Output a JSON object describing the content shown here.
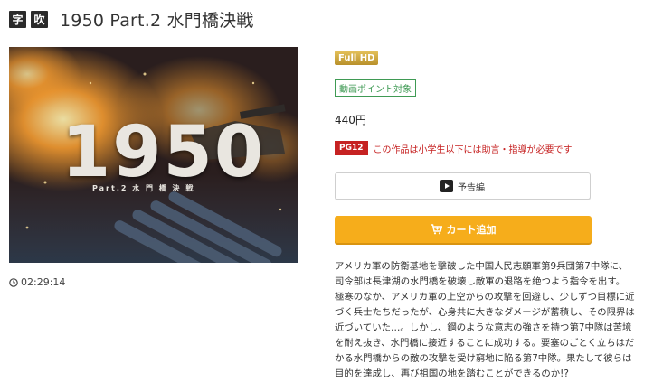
{
  "header": {
    "tags": [
      "字",
      "吹"
    ],
    "title": "1950 Part.2 水門橋決戦"
  },
  "poster": {
    "title_text": "1950",
    "subtitle_text": "Part.2 水 門 橋 決 戦"
  },
  "duration": "02:29:14",
  "badges": {
    "quality": "Full HD",
    "points": "動画ポイント対象"
  },
  "price": "440円",
  "rating": {
    "label": "PG12",
    "note": "この作品は小学生以下には助言・指導が必要です"
  },
  "buttons": {
    "trailer": "予告編",
    "cart": "カート追加"
  },
  "description_lines": [
    "アメリカ軍の防衛基地を撃破した中国人民志願軍第9兵団第7中隊に、",
    "司令部は長津湖の水門橋を破壊し敵軍の退路を絶つよう指令を出す。",
    "極寒のなか、アメリカ軍の上空からの攻撃を回避し、少しずつ目標に近",
    "づく兵士たちだったが、心身共に大きなダメージが蓄積し、その限界は",
    "近づいていた…。しかし、鋼のような意志の強さを持つ第7中隊は苦境",
    "を耐え抜き、水門橋に接近することに成功する。要塞のごとく立ちはだ",
    "かる水門橋からの敵の攻撃を受け窮地に陥る第7中隊。果たして彼らは",
    "目的を達成し、再び祖国の地を踏むことができるのか!?"
  ],
  "colors": {
    "accent_cart": "#f6ad1b",
    "rating_red": "#c62222",
    "points_green": "#3f9a54",
    "hd_gold": "#d4aa42"
  }
}
